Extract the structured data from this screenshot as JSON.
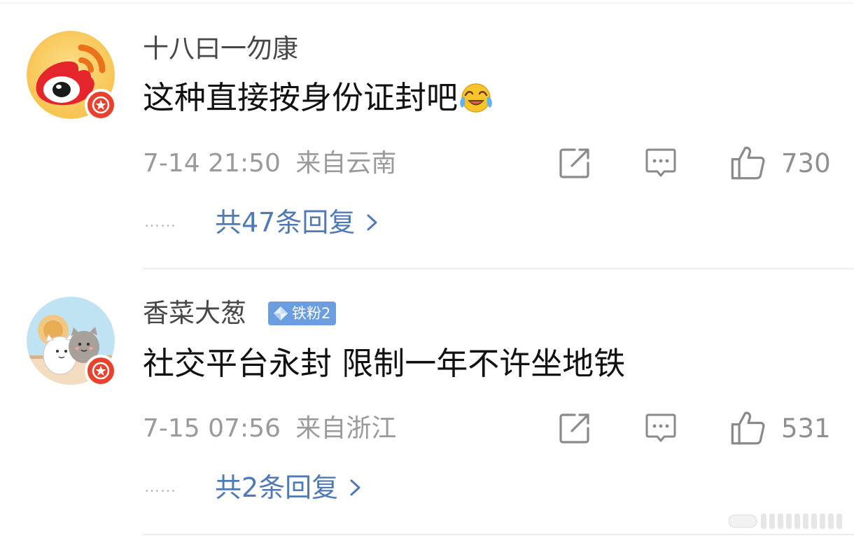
{
  "comments": [
    {
      "username": "十八曰一勿康",
      "text": "这种直接按身份证封吧",
      "emoji_icon": "laugh-cry-emoji-icon",
      "time": "7-14 21:50",
      "location": "来自云南",
      "likes": "730",
      "replies_label": "共47条回复",
      "avatar_icon": "weibo-logo-avatar",
      "badge": null
    },
    {
      "username": "香菜大葱",
      "text": "社交平台永封 限制一年不许坐地铁",
      "time": "7-15 07:56",
      "location": "来自浙江",
      "likes": "531",
      "replies_label": "共2条回复",
      "avatar_icon": "cartoon-cats-avatar",
      "badge": {
        "label": "铁粉2",
        "icon": "diamond-icon",
        "color": "#6b9ee0"
      }
    }
  ],
  "dots": "……",
  "colors": {
    "link": "#4f7ab8",
    "meta": "#9a9a9a",
    "verified": "#e8412e"
  }
}
